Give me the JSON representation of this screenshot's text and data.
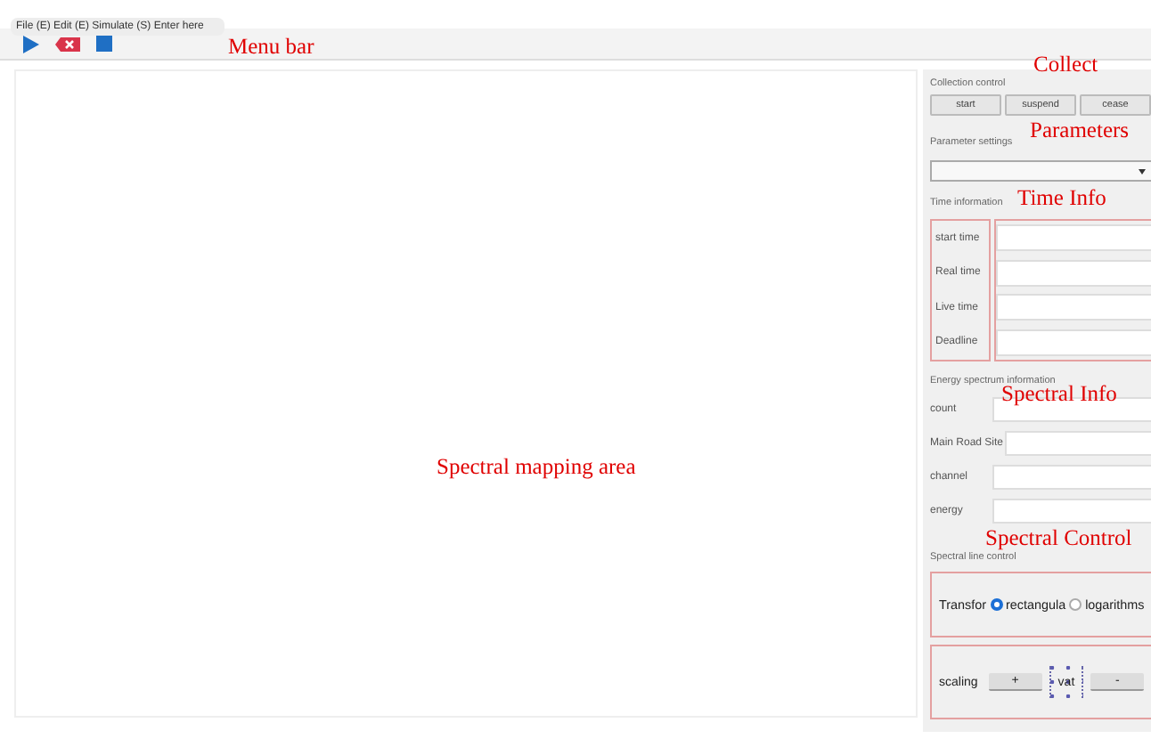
{
  "menu_bar": {
    "text": "File (E) Edit (E) Simulate (S) Enter here"
  },
  "toolbar": [
    {
      "kind": "play"
    },
    {
      "kind": "delete"
    },
    {
      "kind": "stop"
    }
  ],
  "collection_control": {
    "title": "Collection control",
    "buttons": [
      "start",
      "suspend",
      "cease"
    ]
  },
  "parameter_settings": {
    "title": "Parameter settings"
  },
  "time_information": {
    "title": "Time information",
    "fields": [
      {
        "label": "start time"
      },
      {
        "label": "Real time"
      },
      {
        "label": "Live time"
      },
      {
        "label": "Deadline"
      }
    ]
  },
  "energy_spectrum_information": {
    "title": "Energy spectrum information",
    "fields": [
      {
        "label": "count"
      },
      {
        "label": "Main Road Site"
      },
      {
        "label": "channel"
      },
      {
        "label": "energy"
      }
    ]
  },
  "spectral_line_control": {
    "title": "Spectral line control",
    "transform": {
      "label": "Transfor",
      "options": [
        {
          "label": "rectangula",
          "selected": true
        },
        {
          "label": "logarithms",
          "selected": false
        }
      ]
    },
    "scaling": {
      "label": "scaling",
      "controls": [
        {
          "label": "+",
          "kind": "button"
        },
        {
          "label": "vat",
          "kind": "selected-label"
        },
        {
          "label": "-",
          "kind": "button"
        }
      ]
    }
  },
  "annotations": [
    {
      "text": "Menu bar"
    },
    {
      "text": "Collect"
    },
    {
      "text": "Parameters"
    },
    {
      "text": "Time Info"
    },
    {
      "text": "Spectral Info"
    },
    {
      "text": "Spectral Control"
    },
    {
      "text": "Spectral mapping area"
    }
  ]
}
